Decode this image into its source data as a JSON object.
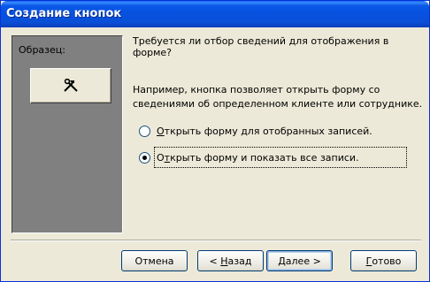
{
  "window": {
    "title": "Создание кнопок"
  },
  "sample": {
    "label": "Образец:",
    "icon": "hammer-wrench-icon"
  },
  "content": {
    "question": "Требуется ли отбор сведений для отображения в форме?",
    "example": "Например, кнопка позволяет открыть форму со сведениями об определенном клиенте или сотруднике."
  },
  "options": [
    {
      "label": "Открыть форму для отобранных записей.",
      "accel": "О",
      "rest": "ткрыть форму для отобранных записей.",
      "checked": false
    },
    {
      "label": "Открыть форму и показать все записи.",
      "accel": "т",
      "prefix": "О",
      "rest": "крыть форму и показать все записи.",
      "checked": true
    }
  ],
  "buttons": {
    "cancel": "Отмена",
    "back_prefix": "< ",
    "back_accel": "Н",
    "back_rest": "азад",
    "next_accel": "Д",
    "next_rest": "алее >",
    "finish_accel": "Г",
    "finish_rest": "отово"
  }
}
